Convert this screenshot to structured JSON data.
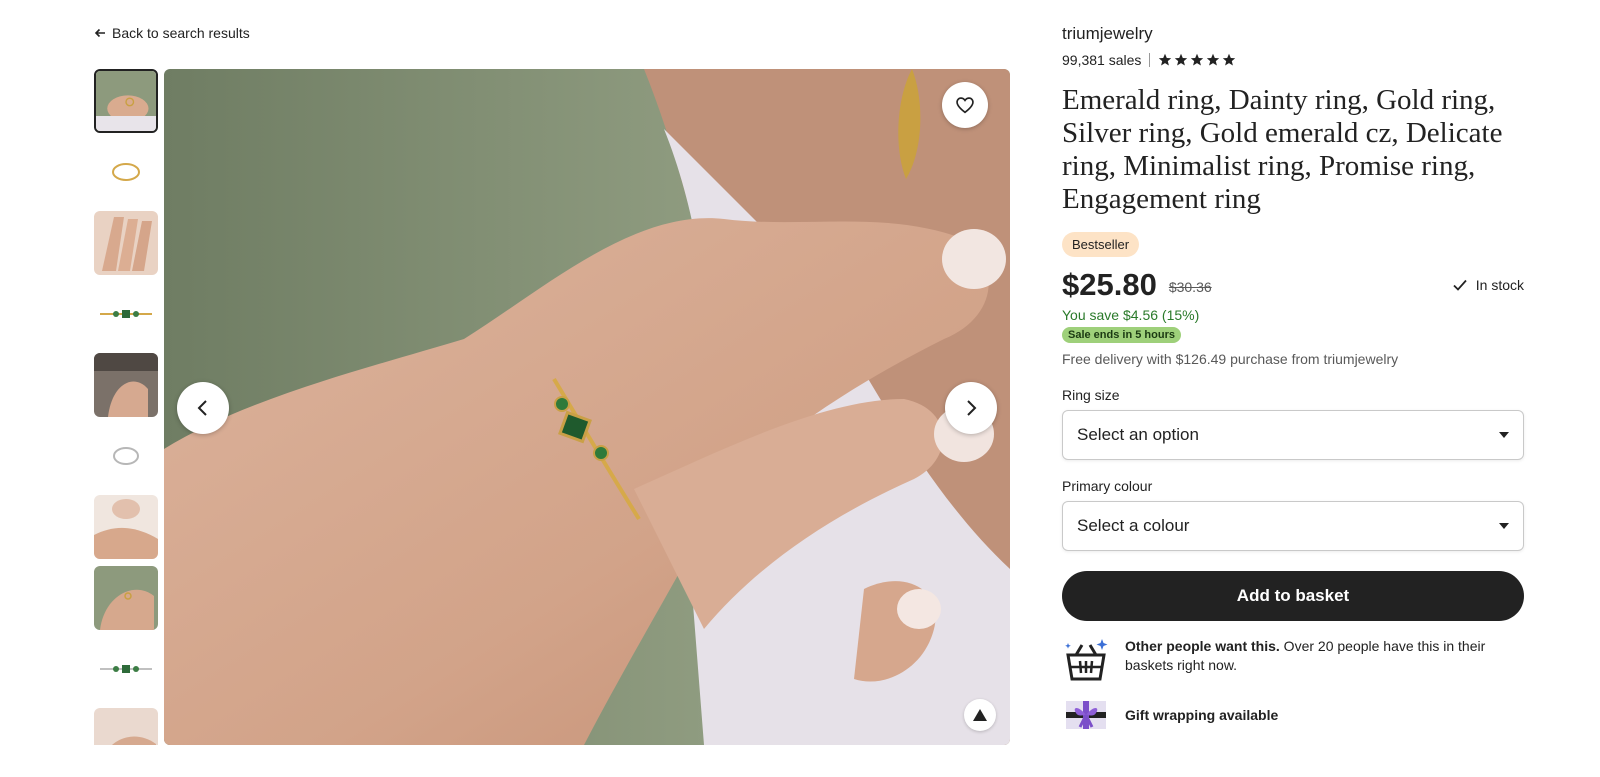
{
  "nav": {
    "back_label": "Back to search results"
  },
  "gallery": {
    "thumbnail_count": 10,
    "active_index": 0
  },
  "shop": {
    "name": "triumjewelry",
    "sales": "99,381 sales",
    "rating_stars": 5
  },
  "listing": {
    "title": "Emerald ring, Dainty ring, Gold ring, Silver ring, Gold emerald cz, Delicate ring, Minimalist ring, Promise ring, Engagement ring",
    "badge": "Bestseller",
    "price": "$25.80",
    "original_price": "$30.36",
    "stock": "In stock",
    "savings": "You save $4.56 (15%)",
    "sale_badge": "Sale ends in 5 hours",
    "delivery": "Free delivery with $126.49 purchase from triumjewelry"
  },
  "options": {
    "ring_size_label": "Ring size",
    "ring_size_value": "Select an option",
    "colour_label": "Primary colour",
    "colour_value": "Select a colour"
  },
  "actions": {
    "add_to_basket": "Add to basket"
  },
  "info": {
    "demand_bold": "Other people want this.",
    "demand_text": " Over 20 people have this in their baskets right now.",
    "gift": "Gift wrapping available"
  },
  "colors": {
    "accent_dark": "#222222",
    "savings_green": "#2a7a2a",
    "sale_badge_bg": "#9ed07a",
    "bestseller_bg": "#fde3c6"
  },
  "icons": {
    "back": "arrow-left-icon",
    "favorite": "heart-icon",
    "prev": "chevron-left-icon",
    "next": "chevron-right-icon",
    "zoom": "zoom-icon",
    "stock": "check-icon",
    "demand": "basket-icon",
    "gift": "gift-icon"
  }
}
